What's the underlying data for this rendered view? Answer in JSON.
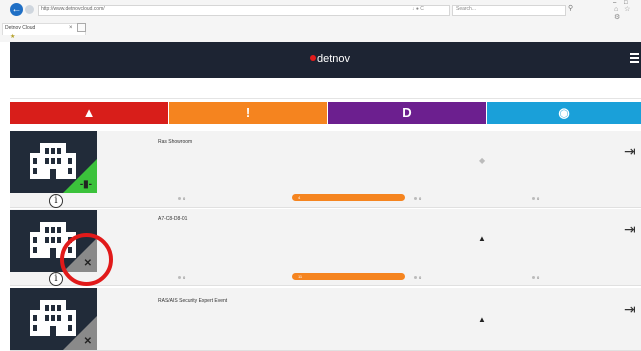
{
  "browser": {
    "url": "http://www.detnovcloud.com/",
    "url_controls": "↓ ● C",
    "search_placeholder": "Search...",
    "tab_label": "Detnov Cloud",
    "tab_close": "×",
    "window_controls": "– □",
    "toolbar_icons": "⌂ ☆ ⚙"
  },
  "app": {
    "logo": "detnov",
    "brand_color": "#1d2433"
  },
  "categories": [
    {
      "label": "▲",
      "color": "#d81e1a",
      "name": "fire"
    },
    {
      "label": "!",
      "color": "#f5841f",
      "name": "warning"
    },
    {
      "label": "D",
      "color": "#6c1f8f",
      "name": "disablement"
    },
    {
      "label": "◉",
      "color": "#1aa0d9",
      "name": "service"
    }
  ],
  "sites": [
    {
      "name": "Ras Showroom",
      "connection": "connected",
      "corner_glyph": "-▮-",
      "status_icon": "◆",
      "stats": [
        "0",
        "4",
        "0",
        "0"
      ]
    },
    {
      "name": "A7-C8-D8-01",
      "connection": "disconnected",
      "corner_glyph": "✕",
      "status_icon": "▲",
      "stats": [
        "0",
        "11",
        "0",
        "0"
      ]
    },
    {
      "name": "RAS/AIS Security Expert Event",
      "connection": "disconnected",
      "corner_glyph": "✕",
      "status_icon": "▲",
      "stats": []
    }
  ],
  "info_glyph": "i",
  "enter_glyph": "⇥"
}
